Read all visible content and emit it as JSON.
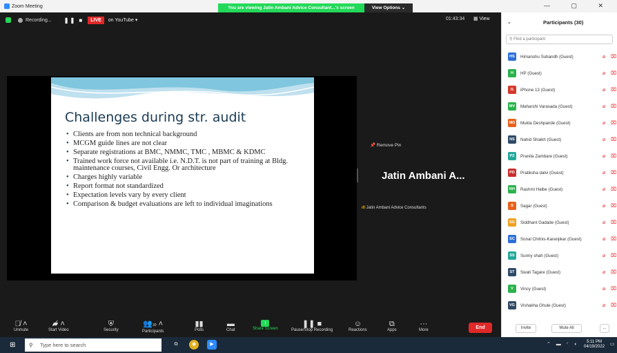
{
  "window": {
    "app_title": "Zoom Meeting",
    "viewing_banner": "You are viewing Jatin Ambani Advice Consultant...'s screen",
    "view_options": "View Options ⌄",
    "controls": "—   ▢   ✕"
  },
  "topbar": {
    "recording_label": "Recording...",
    "pause_stop": "❚❚  ■",
    "live_badge": "LIVE",
    "on_youtube": "on YouTube ▾",
    "timer": "01:43:34",
    "view_label": "▦ View"
  },
  "slide": {
    "title": "Challenges during str. audit",
    "bullets": [
      "Clients are from non technical background",
      "MCGM guide lines are not clear",
      "Separate registrations at BMC, NMMC, TMC , MBMC & KDMC",
      "Trained work force not available i.e. N.D.T. is not part of training at Bldg. maintenance courses, Civil Engg. Or architecture",
      "Charges highly variable",
      "Report format not standardized",
      "Expectation levels vary by every client",
      "Comparison & budget evaluations are left to individual imaginations"
    ]
  },
  "pinned": {
    "remove_pin": "Remove Pin",
    "name": "Jatin Ambani A...",
    "speaker_label": "Jatin Ambani Advice Consultants"
  },
  "toolbar": {
    "unmute": "Unmute",
    "start_video": "Start Video",
    "security": "Security",
    "participants": "Participants",
    "participants_count": "30",
    "polls": "Polls",
    "chat": "Chat",
    "share_screen": "Share Screen",
    "pause_stop_recording": "Pause/Stop Recording",
    "reactions": "Reactions",
    "apps": "Apps",
    "more": "More",
    "end": "End"
  },
  "panel": {
    "title": "Participants (30)",
    "search_placeholder": "Find a participant",
    "participants": [
      {
        "initials": "HS",
        "name": "Himanshu Subandh (Guest)",
        "color": "#2d6fd6"
      },
      {
        "initials": "H",
        "name": "HP (Guest)",
        "color": "#2bb24c"
      },
      {
        "initials": "I1",
        "name": "iPhone 13 (Guest)",
        "color": "#d4382c"
      },
      {
        "initials": "MV",
        "name": "Maharshi Varasada (Guest)",
        "color": "#2bb24c"
      },
      {
        "initials": "MD",
        "name": "Mukta Deshpande (Guest)",
        "color": "#e8601c"
      },
      {
        "initials": "NS",
        "name": "Nahid Shaikh (Guest)",
        "color": "#2f4a66"
      },
      {
        "initials": "PZ",
        "name": "Pranita Zambare (Guest)",
        "color": "#22a89a"
      },
      {
        "initials": "PD",
        "name": "Pratiksha dalvi (Guest)",
        "color": "#c8302c"
      },
      {
        "initials": "RH",
        "name": "Rashmi Halbe (Guest)",
        "color": "#2bb24c"
      },
      {
        "initials": "S",
        "name": "Sagar (Guest)",
        "color": "#e8601c"
      },
      {
        "initials": "SG",
        "name": "Siddhant Gadade (Guest)",
        "color": "#f0a020"
      },
      {
        "initials": "SC",
        "name": "Sonal Chitnis-Karanjikar (Guest)",
        "color": "#2d6fd6"
      },
      {
        "initials": "SS",
        "name": "Sunny shah (Guest)",
        "color": "#22a89a"
      },
      {
        "initials": "ST",
        "name": "Swati Tagare (Guest)",
        "color": "#2f4a66"
      },
      {
        "initials": "V",
        "name": "Vincy (Guest)",
        "color": "#2bb24c"
      },
      {
        "initials": "VG",
        "name": "Vishakha Ghule (Guest)",
        "color": "#2f4a66"
      }
    ],
    "invite": "Invite",
    "mute_all": "Mute All",
    "more": "..."
  },
  "taskbar": {
    "search_placeholder": "Type here to search",
    "time": "5:11 PM",
    "date": "04/19/2022"
  }
}
